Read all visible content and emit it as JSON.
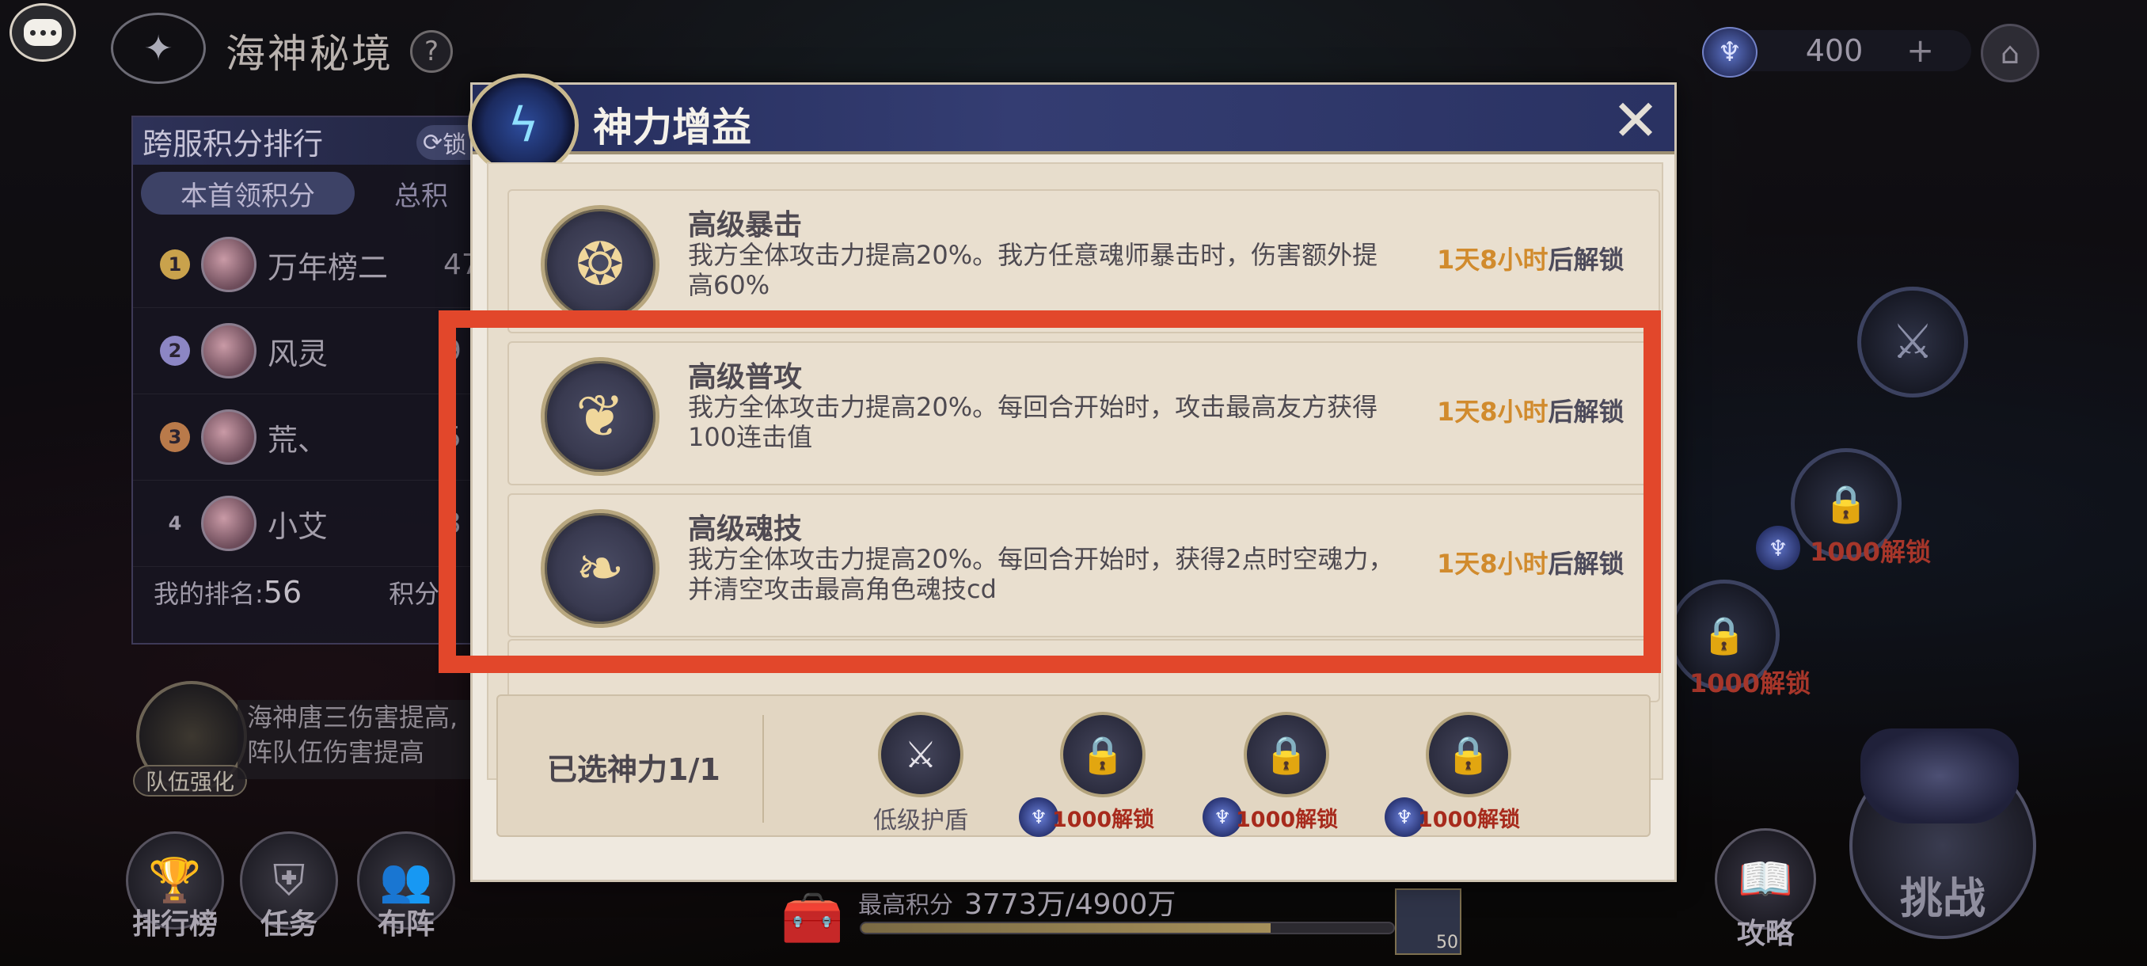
{
  "header": {
    "map_title": "海神秘境",
    "help_icon": "?"
  },
  "leaderboard": {
    "title": "跨服积分排行",
    "refresh_label": "锁",
    "tabs": [
      "本首领积分",
      "总积"
    ],
    "rows": [
      {
        "rank": "1",
        "name": "万年榜二",
        "score": "47",
        "badge_color": "#c9a24c"
      },
      {
        "rank": "2",
        "name": "风灵",
        "score": "9",
        "badge_color": "#8c86c4"
      },
      {
        "rank": "3",
        "name": "荒、",
        "score": "5",
        "badge_color": "#b97a4a"
      },
      {
        "rank": "4",
        "name": "小艾",
        "score": "3",
        "badge_color": "transparent"
      }
    ],
    "my_rank_label": "我的排名:",
    "my_rank_value": "56",
    "points_label": "积分"
  },
  "team_buff": {
    "label": "队伍强化",
    "desc_line1": "海神唐三伤害提高,",
    "desc_line2": "阵队伍伤害提高"
  },
  "bottom_nav": [
    {
      "label": "排行榜",
      "icon": "trophy-icon",
      "glyph": "🏆"
    },
    {
      "label": "任务",
      "icon": "shield-icon",
      "glyph": "⛨"
    },
    {
      "label": "布阵",
      "icon": "team-icon",
      "glyph": "👥"
    }
  ],
  "currency": {
    "value": "400",
    "plus": "+",
    "icon": "trident-gem-icon"
  },
  "right_nodes": [
    {
      "unlock": "1000解锁"
    },
    {
      "unlock": "1000解锁"
    }
  ],
  "strategy": {
    "label": "攻略"
  },
  "challenge": {
    "label": "挑战"
  },
  "progress": {
    "label": "最高积分",
    "value": "3773万/4900万",
    "fraction": 0.77,
    "reward_count": "50"
  },
  "modal": {
    "title": "神力增益",
    "close": "✕",
    "buffs": [
      {
        "name": "高级暴击",
        "desc": "我方全体攻击力提高20%。我方任意魂师暴击时，伤害额外提高60%",
        "unlock_time": "1天8小时",
        "unlock_suffix": "后解锁",
        "icon": "crit-emblem-icon"
      },
      {
        "name": "高级普攻",
        "desc": "我方全体攻击力提高20%。每回合开始时，攻击最高友方获得100连击值",
        "unlock_time": "1天8小时",
        "unlock_suffix": "后解锁",
        "icon": "attack-emblem-icon"
      },
      {
        "name": "高级魂技",
        "desc": "我方全体攻击力提高20%。每回合开始时，获得2点时空魂力，并清空攻击最高角色魂技cd",
        "unlock_time": "1天8小时",
        "unlock_suffix": "后解锁",
        "icon": "skill-emblem-icon"
      }
    ],
    "selected_label": "已选神力1/1",
    "slots": [
      {
        "label": "低级护盾",
        "type": "selected",
        "icon": "sword-shield-icon"
      },
      {
        "label": "1000解锁",
        "type": "locked",
        "icon": "lock-icon"
      },
      {
        "label": "1000解锁",
        "type": "locked",
        "icon": "lock-icon"
      },
      {
        "label": "1000解锁",
        "type": "locked",
        "icon": "lock-icon"
      }
    ]
  },
  "colors": {
    "highlight": "#e2472b",
    "unlock_time": "#d18b2d",
    "lock_price": "#a72a1c",
    "modal_header": "#2a3262"
  }
}
